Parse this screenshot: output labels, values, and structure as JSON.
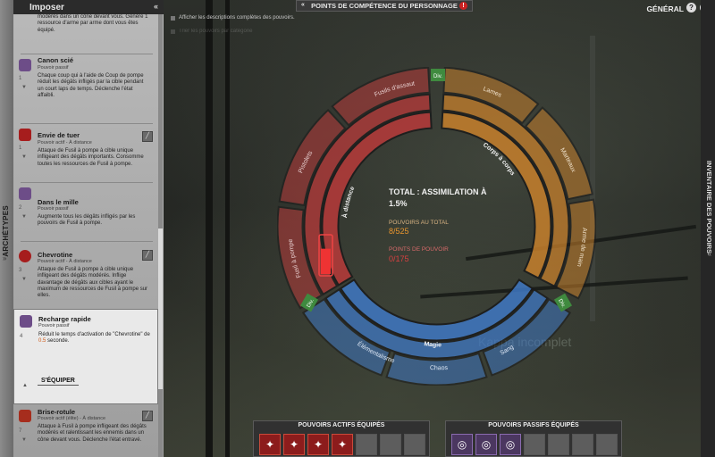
{
  "background": {
    "watermark": "Kappa incomplet"
  },
  "archetypes_tab": {
    "label": "ARCHÉTYPES"
  },
  "inventory_tab": {
    "label": "INVENTAIRE DES POUVOIRS"
  },
  "panel": {
    "title": "Imposer",
    "powers": [
      {
        "name": "",
        "type": "",
        "description": "modérés dans un cône devant vous. Génère 1 ressource d'arme par arme dont vous êtes équipé.",
        "rank": "",
        "icon": "power-icon"
      },
      {
        "name": "Canon scié",
        "type": "Pouvoir passif",
        "description": "Chaque coup qui à l'aide de Coup de pompe réduit les dégâts infligés par la cible pendant un court laps de temps. Déclenche l'état affaibli.",
        "rank": "1",
        "icon": "shotgun-sawed-icon"
      },
      {
        "name": "Envie de tuer",
        "type": "Pouvoir actif - À distance",
        "description": "Attaque de Fusil à pompe à cible unique infligeant des dégâts importants. Consomme toutes les ressources de Fusil à pompe.",
        "rank": "1",
        "icon": "shotgun-blast-icon"
      },
      {
        "name": "Dans le mille",
        "type": "Pouvoir passif",
        "description": "Augmente tous les dégâts infligés par les pouvoirs de Fusil à pompe.",
        "rank": "2",
        "icon": "target-hand-icon"
      },
      {
        "name": "Chevrotine",
        "type": "Pouvoir actif - À distance",
        "description": "Attaque de Fusil à pompe à cible unique infligeant des dégâts modérés. Inflige davantage de dégâts aux cibles ayant le maximum de ressources de Fusil à pompe sur elles.",
        "rank": "3",
        "icon": "buckshot-icon"
      },
      {
        "name": "Recharge rapide",
        "type": "Pouvoir passif",
        "description_before": "Réduit le temps d'activation de \"Chevrotine\" de ",
        "description_highlight": "0.5",
        "description_after": " seconde.",
        "rank": "4",
        "icon": "reload-icon"
      },
      {
        "name": "Brise-rotule",
        "type": "Pouvoir actif (élite) - À distance",
        "description": "Attaque à Fusil à pompe infligeant des dégâts modérés et ralentissant les ennemis dans un cône devant vous. Déclenche l'état entravé.",
        "rank": "7",
        "icon": "kneecap-icon"
      }
    ],
    "equip_label": "S'ÉQUIPER"
  },
  "options": {
    "full_descriptions": "Afficher les descriptions complètes des pouvoirs.",
    "second_option": "Trier les pouvoirs par catégorie"
  },
  "header": {
    "title": "POINTS DE COMPÉTENCE DU PERSONNAGE",
    "alert": "!",
    "general": "GÉNÉRAL",
    "help": "?",
    "help2": "?"
  },
  "wheel": {
    "center_title": "TOTAL : ASSIMILATION À 1.5%",
    "powers_label": "POUVOIRS AU TOTAL",
    "powers_value": "8/525",
    "points_label": "POINTS DE POUVOIR",
    "points_value": "0/175",
    "div_label": "Div.",
    "segments": {
      "red_outer": [
        "Fusils d'assaut",
        "Pistolets",
        "Fusil à pompe"
      ],
      "red_inner": "À distance",
      "orange_outer": [
        "Lames",
        "Marteaux",
        "Arme de main"
      ],
      "orange_inner": "Corps à corps",
      "blue_outer": [
        "Élémentalisme",
        "Chaos",
        "Sang"
      ],
      "blue_inner": "Magie"
    },
    "fill_fraction": 0.015
  },
  "bottom": {
    "active_title": "POUVOIRS ACTIFS ÉQUIPÉS",
    "passive_title": "POUVOIRS PASSIFS ÉQUIPÉS",
    "active_slots": [
      "shotgun-blast-icon",
      "hammer-icon",
      "shotgun-wing-icon",
      "buckshot-icon",
      "",
      "",
      ""
    ],
    "passive_slots": [
      "shotgun-sawed-icon",
      "reload-icon",
      "target-hand-icon",
      "",
      "",
      "",
      ""
    ]
  },
  "colors": {
    "ranged": "#b83a3a",
    "melee": "#c7802c",
    "magic": "#3f78c4",
    "highlight": "#e8952e"
  }
}
